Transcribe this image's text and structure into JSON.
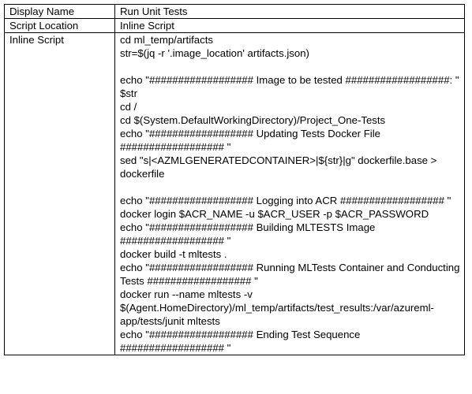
{
  "rows": [
    {
      "label": "Display Name",
      "value": "Run Unit Tests"
    },
    {
      "label": "Script Location",
      "value": "Inline Script"
    }
  ],
  "script_row": {
    "label": "Inline Script",
    "lines": [
      "cd ml_temp/artifacts",
      "str=$(jq -r '.image_location' artifacts.json)",
      "",
      "echo \"################## Image to be tested ##################: \" $str",
      "cd /",
      "cd $(System.DefaultWorkingDirectory)/Project_One-Tests",
      "echo \"################## Updating Tests Docker File ################## \"",
      "sed \"s|<AZMLGENERATEDCONTAINER>|${str}|g\" dockerfile.base > dockerfile",
      "",
      "echo \"################## Logging into ACR ################## \"",
      "docker login $ACR_NAME -u $ACR_USER -p $ACR_PASSWORD",
      "echo \"################## Building MLTESTS Image ################## \"",
      "docker build -t mltests .",
      "echo \"################## Running MLTests Container and Conducting Tests ################## \"",
      "docker run --name mltests -v $(Agent.HomeDirectory)/ml_temp/artifacts/test_results:/var/azureml-app/tests/junit mltests",
      "echo \"################## Ending Test Sequence ################## \""
    ]
  }
}
